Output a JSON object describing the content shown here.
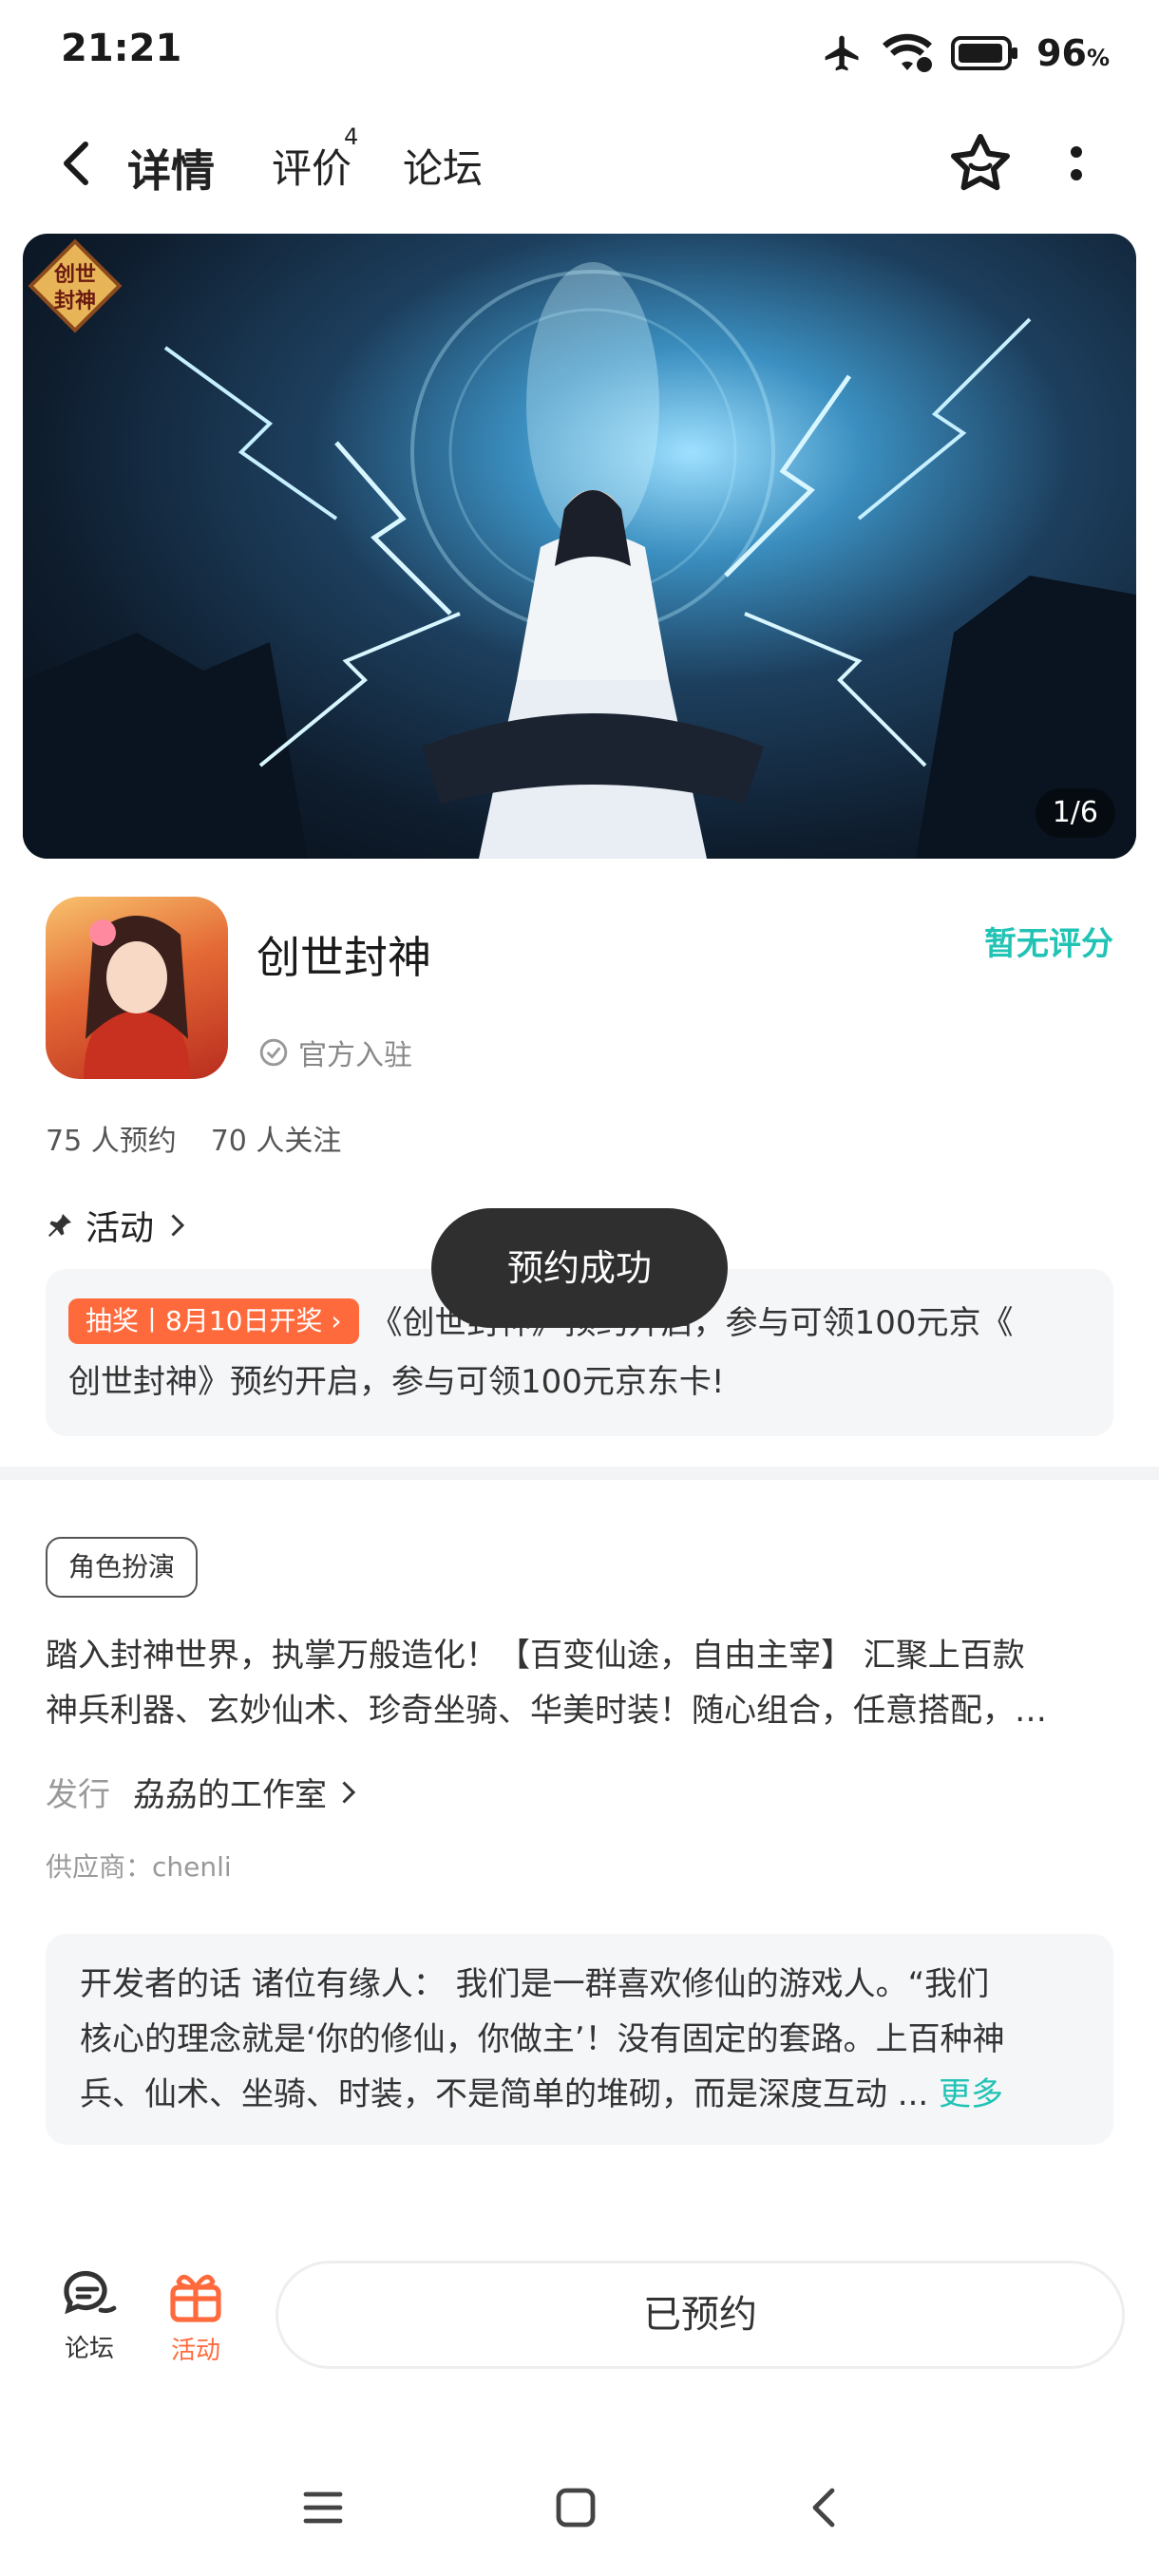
{
  "status_bar": {
    "time": "21:21",
    "battery": "96",
    "battery_unit": "%"
  },
  "nav": {
    "tabs": [
      {
        "label": "详情",
        "active": true
      },
      {
        "label": "评价",
        "badge": "4"
      },
      {
        "label": "论坛"
      }
    ]
  },
  "banner": {
    "counter": "1/6",
    "logo_text": "创世封神"
  },
  "app": {
    "name": "创世封神",
    "official": "官方入驻",
    "rating": "暂无评分",
    "reservations": "75 人预约",
    "followers": "70 人关注"
  },
  "activity": {
    "title": "活动",
    "tag": "抽奖丨8月10日开奖",
    "text_line1": "《创世封神》预约开启，参与可领100元京《",
    "text_line2": "创世封神》预约开启，参与可领100元京东卡!"
  },
  "toast": {
    "text": "预约成功"
  },
  "info": {
    "genre": "角色扮演",
    "desc_line1": "踏入封神世界，执掌万般造化！【百变仙途，自由主宰】 汇聚上百款",
    "desc_line2": "神兵利器、玄妙仙术、珍奇坐骑、华美时装！随心组合，任意搭配，…",
    "publisher_label": "发行",
    "publisher": "劦劦的工作室",
    "supplier": "供应商：chenli"
  },
  "developer": {
    "line1": "开发者的话  诸位有缘人： 我们是一群喜欢修仙的游戏人。“我们",
    "line2": "核心的理念就是‘你的修仙，你做主’！没有固定的套路。上百种神",
    "line3": "兵、仙术、坐骑、时装，不是简单的堆砌，而是深度互动 ... ",
    "more": "更多"
  },
  "bottom": {
    "forum": "论坛",
    "activity": "活动",
    "reserved": "已预约"
  },
  "colors": {
    "accent": "#21c3b5",
    "orange": "#ff6a3d"
  }
}
